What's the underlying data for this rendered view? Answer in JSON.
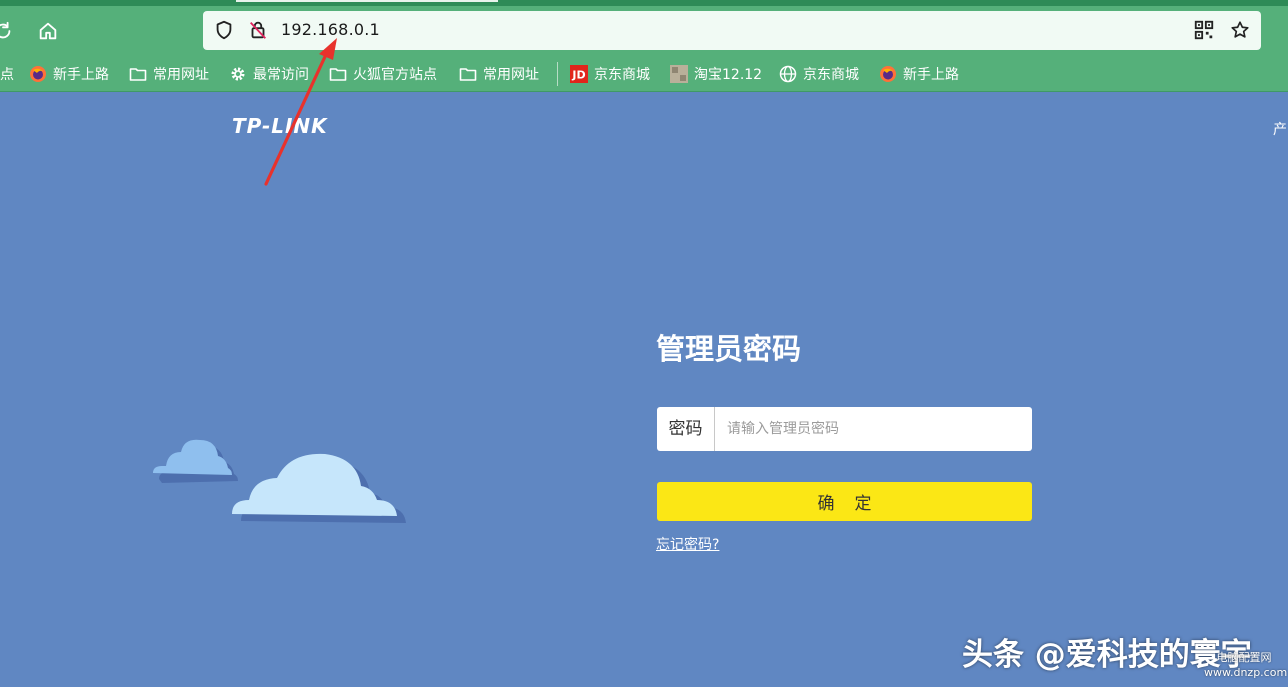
{
  "browser": {
    "url": "192.168.0.1",
    "bookmarks": [
      {
        "label": "点",
        "icon": "none"
      },
      {
        "label": "新手上路",
        "icon": "firefox-icon"
      },
      {
        "label": "常用网址",
        "icon": "folder-icon"
      },
      {
        "label": "最常访问",
        "icon": "gear-icon"
      },
      {
        "label": "火狐官方站点",
        "icon": "folder-icon"
      },
      {
        "label": "常用网址",
        "icon": "folder-icon"
      },
      {
        "label": "京东商城",
        "icon": "jd-icon"
      },
      {
        "label": "淘宝12.12",
        "icon": "taobao-icon"
      },
      {
        "label": "京东商城",
        "icon": "globe-icon"
      },
      {
        "label": "新手上路",
        "icon": "firefox-icon"
      }
    ]
  },
  "page": {
    "logo": "TP-LINK",
    "edge_text": "产",
    "title": "管理员密码",
    "password_label": "密码",
    "password_placeholder": "请输入管理员密码",
    "password_value": "",
    "confirm_label": "确定",
    "forgot_label": "忘记密码?"
  },
  "overlay": {
    "watermark": "头条 @爱科技的寰宇",
    "site_mark_line1": "电脑配置网",
    "site_mark_line2": "www.dnzp.com"
  },
  "colors": {
    "page_bg": "#6087c2",
    "toolbar_bg": "#55b07a",
    "button_yellow": "#fbe715",
    "arrow_red": "#e8322c"
  }
}
